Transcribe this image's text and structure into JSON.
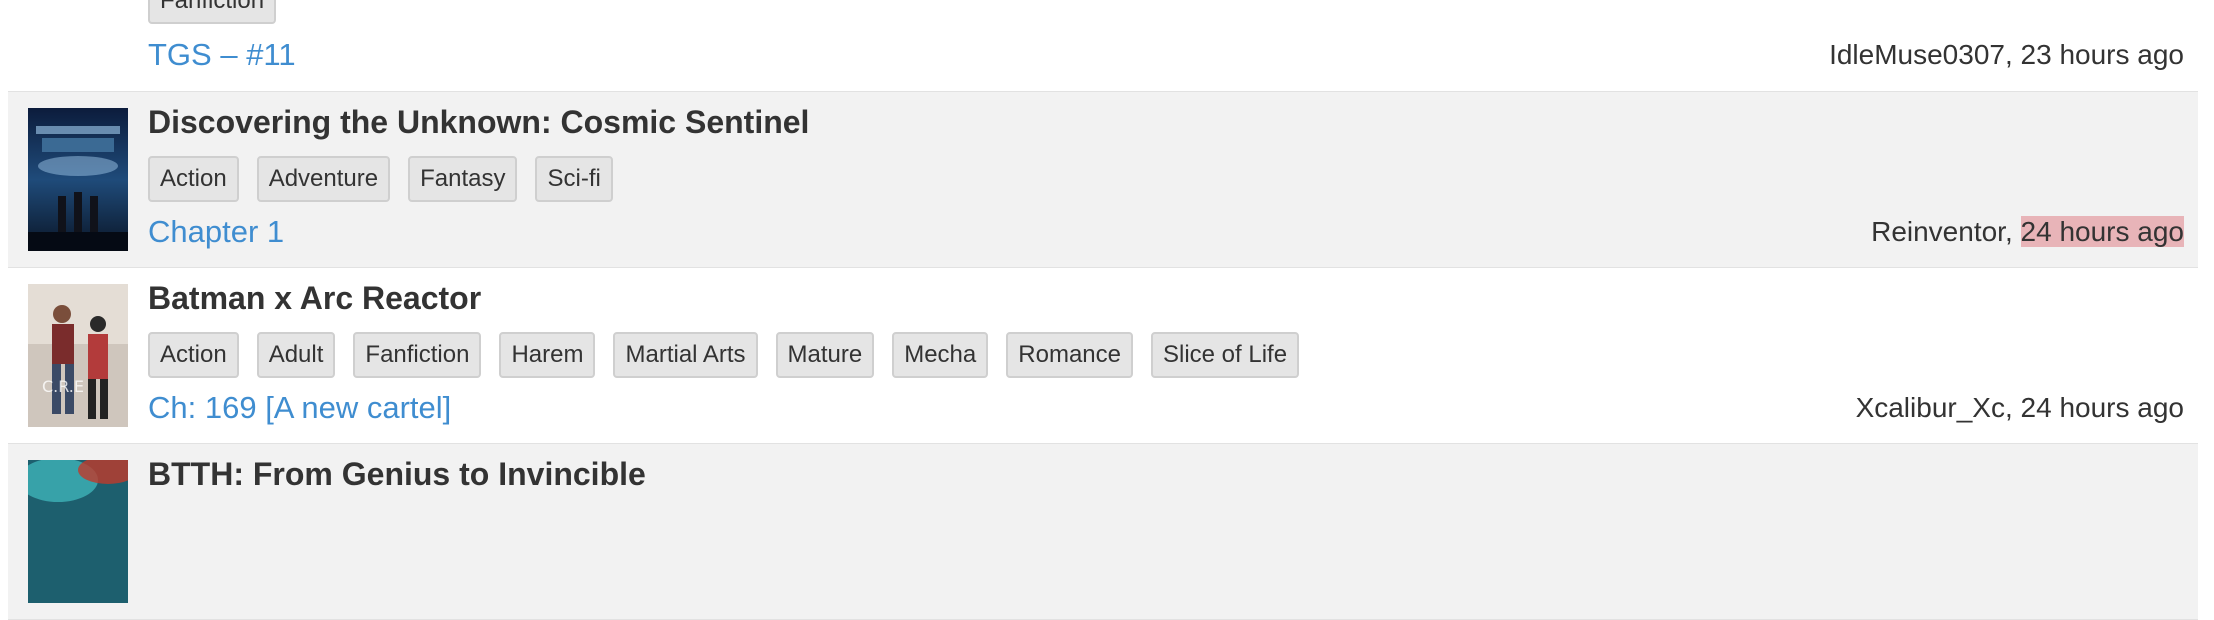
{
  "items": [
    {
      "title": "",
      "tags": [
        "Fanfiction"
      ],
      "chapter": "TGS – #11",
      "author": "IdleMuse0307",
      "separator": ",",
      "time": "23 hours ago"
    },
    {
      "title": "Discovering the Unknown: Cosmic Sentinel",
      "tags": [
        "Action",
        "Adventure",
        "Fantasy",
        "Sci-fi"
      ],
      "chapter": "Chapter 1",
      "author": "Reinventor",
      "separator": ",",
      "time": "24 hours ago"
    },
    {
      "title": "Batman x Arc Reactor",
      "tags": [
        "Action",
        "Adult",
        "Fanfiction",
        "Harem",
        "Martial Arts",
        "Mature",
        "Mecha",
        "Romance",
        "Slice of Life"
      ],
      "chapter": "Ch: 169 [A new cartel]",
      "author": "Xcalibur_Xc",
      "separator": ",",
      "time": "24 hours ago"
    },
    {
      "title": "BTTH: From Genius to Invincible",
      "tags": [],
      "chapter": "",
      "author": "",
      "separator": "",
      "time": ""
    }
  ],
  "colors": {
    "link": "#3f8dd0",
    "highlight": "#e8b4b8",
    "alt_row": "#f2f2f2"
  }
}
